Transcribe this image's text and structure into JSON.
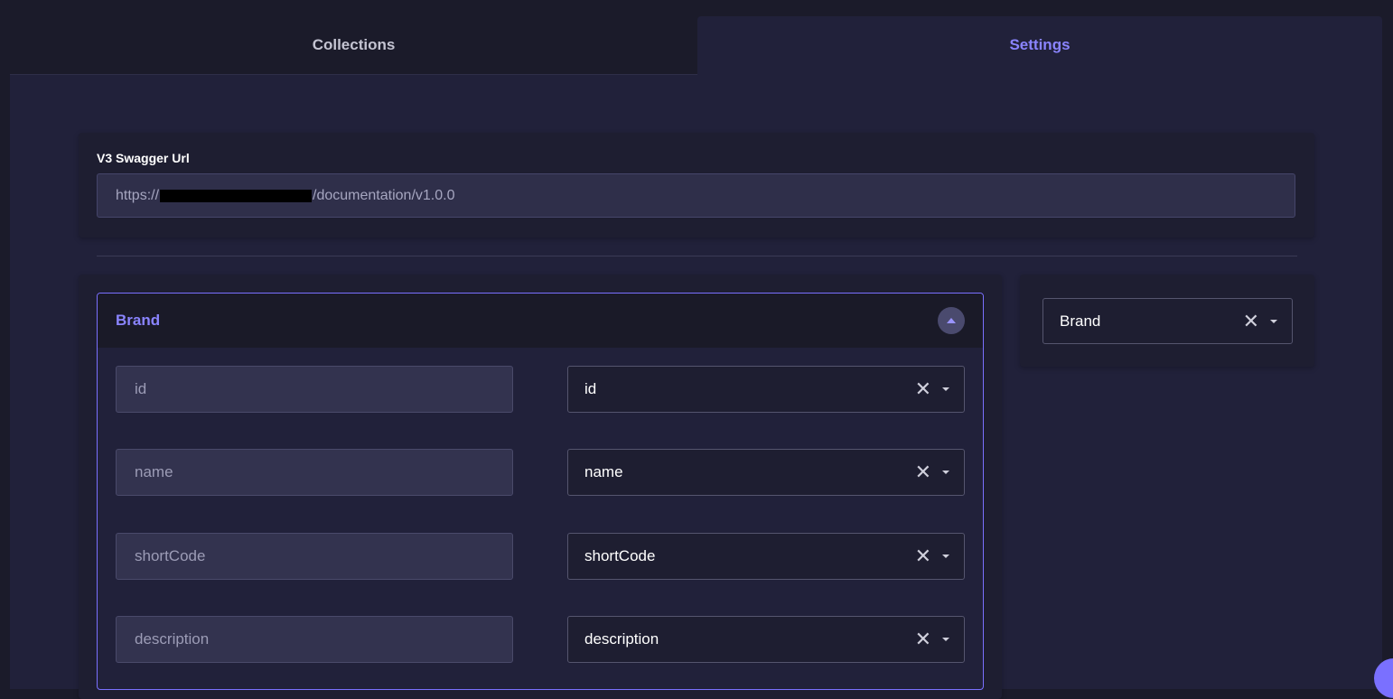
{
  "tabs": [
    {
      "label": "Collections",
      "active": false
    },
    {
      "label": "Settings",
      "active": true
    }
  ],
  "swagger": {
    "label": "V3 Swagger Url",
    "url_prefix": "https://",
    "url_suffix": "/documentation/v1.0.0"
  },
  "collection": {
    "title": "Brand",
    "fields": [
      {
        "placeholder": "id",
        "selected": "id"
      },
      {
        "placeholder": "name",
        "selected": "name"
      },
      {
        "placeholder": "shortCode",
        "selected": "shortCode"
      },
      {
        "placeholder": "description",
        "selected": "description"
      }
    ]
  },
  "side_select": {
    "selected": "Brand"
  },
  "colors": {
    "accent": "#7a70ff",
    "background": "#1b1b2a",
    "panel": "#21213a"
  },
  "icons": {
    "clear": "close-icon",
    "dropdown": "caret-down-icon",
    "collapse": "chevron-up-icon"
  }
}
